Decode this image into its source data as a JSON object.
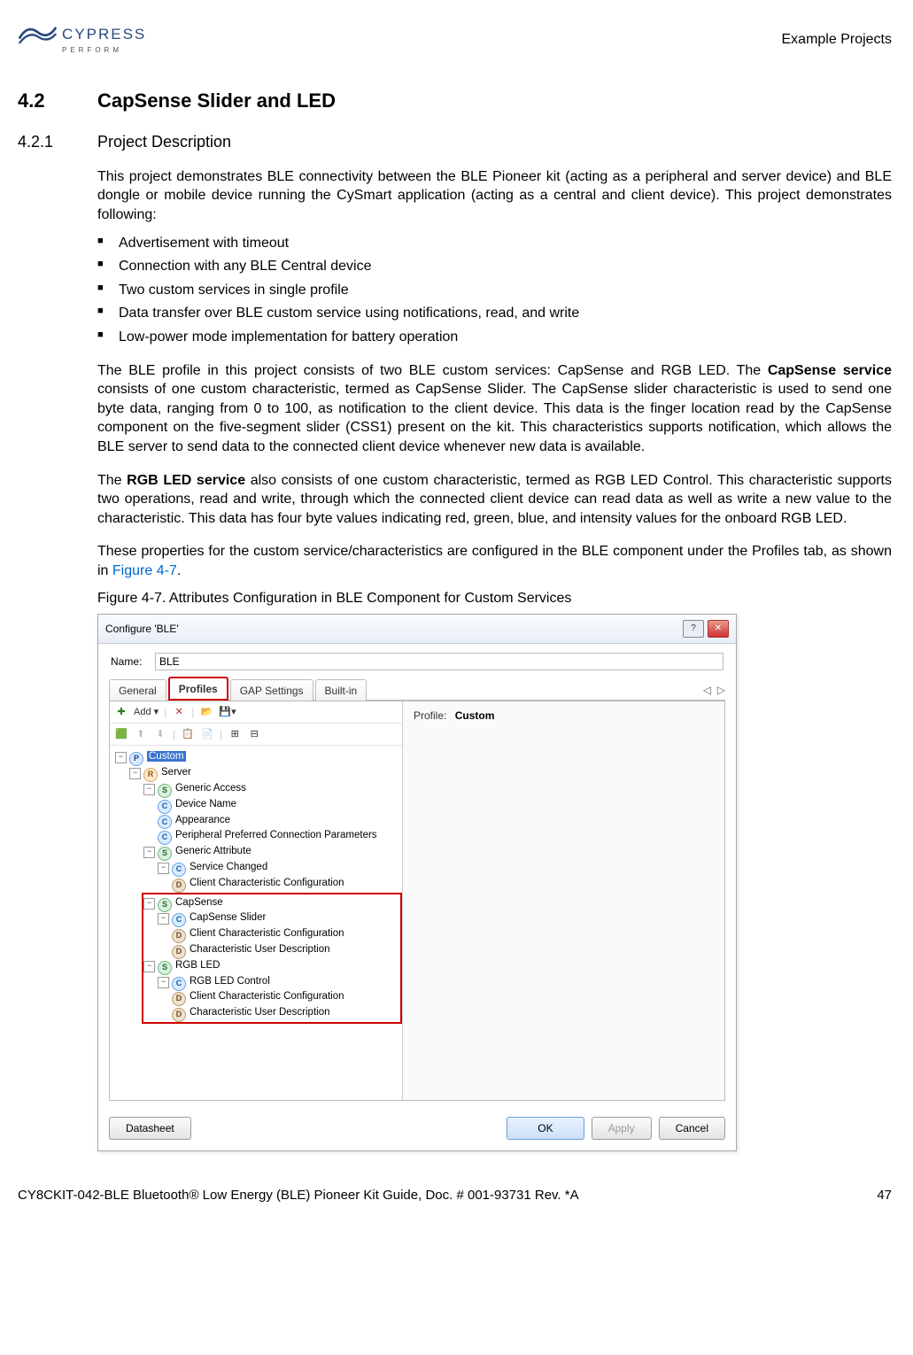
{
  "header": {
    "logo_main": "CYPRESS",
    "logo_sub": "PERFORM",
    "right": "Example Projects"
  },
  "section": {
    "num": "4.2",
    "title": "CapSense Slider and LED"
  },
  "subsection": {
    "num": "4.2.1",
    "title": "Project Description"
  },
  "para1": "This project demonstrates BLE connectivity between the BLE Pioneer kit (acting as a peripheral and server device) and BLE dongle or mobile device running the CySmart application (acting as a central and client device). This project demonstrates following:",
  "bullets": [
    "Advertisement with timeout",
    "Connection with any BLE Central device",
    "Two custom services in single profile",
    "Data transfer over BLE custom service using notifications, read, and write",
    "Low-power mode implementation for battery operation"
  ],
  "para2a": "The BLE profile in this project consists of two BLE custom services: CapSense and RGB LED. The ",
  "para2b": "CapSense service",
  "para2c": " consists of one custom characteristic, termed as CapSense Slider. The CapSense slider characteristic is used to send one byte data, ranging from 0 to 100, as notification to the client device. This data is the finger location read by the CapSense component on the five-segment slider (CSS1) present on the kit. This characteristics supports notification, which allows the BLE server to send data to the connected client device whenever new data is available.",
  "para3a": "The ",
  "para3b": "RGB LED service",
  "para3c": " also consists of one custom characteristic, termed as RGB LED Control. This characteristic supports two operations, read and write, through which the connected client device can read data as well as write a new value to the characteristic. This data has four byte values indicating red, green, blue, and intensity values for the onboard RGB LED.",
  "para4a": "These properties for the custom service/characteristics are configured in the BLE component under the Profiles tab, as shown in ",
  "para4link": "Figure 4-7",
  "para4b": ".",
  "figcap": "Figure 4-7.  Attributes Configuration in BLE Component for Custom Services",
  "dialog": {
    "title": "Configure 'BLE'",
    "name_label": "Name:",
    "name_value": "BLE",
    "tabs": [
      "General",
      "Profiles",
      "GAP Settings",
      "Built-in"
    ],
    "toolbar1": {
      "add": "Add ▾",
      "delete": "✕"
    },
    "profile_label": "Profile:",
    "profile_value": "Custom",
    "tree": {
      "root": "Custom",
      "server": "Server",
      "ga": "Generic Access",
      "ga_c1": "Device Name",
      "ga_c2": "Appearance",
      "ga_c3": "Peripheral Preferred Connection Parameters",
      "gatt": "Generic Attribute",
      "gatt_c1": "Service Changed",
      "gatt_d1": "Client Characteristic Configuration",
      "cap": "CapSense",
      "cap_c1": "CapSense Slider",
      "cap_d1": "Client Characteristic Configuration",
      "cap_d2": "Characteristic User Description",
      "rgb": "RGB LED",
      "rgb_c1": "RGB LED Control",
      "rgb_d1": "Client Characteristic Configuration",
      "rgb_d2": "Characteristic User Description"
    },
    "buttons": {
      "datasheet": "Datasheet",
      "ok": "OK",
      "apply": "Apply",
      "cancel": "Cancel"
    }
  },
  "footer": {
    "left": "CY8CKIT-042-BLE Bluetooth® Low Energy (BLE) Pioneer Kit Guide, Doc. # 001-93731 Rev. *A",
    "right": "47"
  }
}
